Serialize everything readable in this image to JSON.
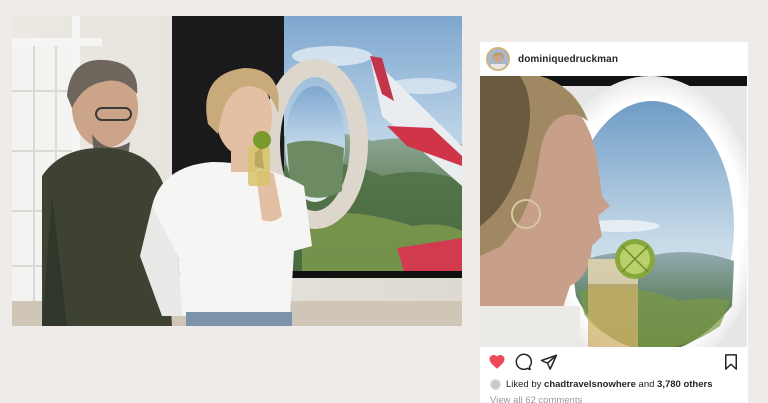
{
  "post": {
    "username": "dominiquedruckman",
    "liked_by_prefix": "Liked by",
    "liked_by_user": "chadtravelsnowhere",
    "liked_by_and": "and",
    "liked_by_count": "3,780 others",
    "view_comments": "View all 62 comments"
  },
  "icons": {
    "like": "heart-icon",
    "comment": "comment-icon",
    "share": "share-icon",
    "bookmark": "bookmark-icon"
  },
  "colors": {
    "background": "#eeebe8",
    "like_red": "#ed4956",
    "text": "#262626",
    "muted": "#999999"
  }
}
